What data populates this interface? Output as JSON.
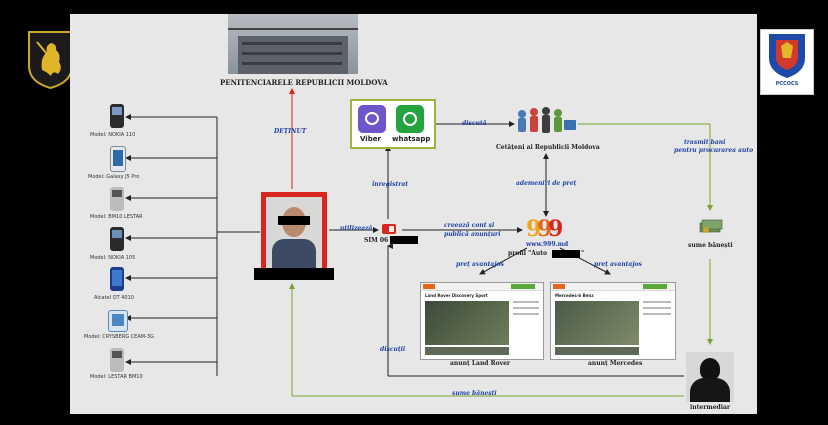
{
  "title": "PENITENCIARELE REPUBLICII MOLDOVA",
  "links": {
    "detinut": "DEȚINUT",
    "discuta": "discută",
    "inregistrat": "înregistrat",
    "utilizeaza": "utilizează",
    "creeaza_cont": "creează cont și",
    "publica_anunturi": "publică anunțuri",
    "ademeniri": "ademeniri de preț",
    "transmit_bani": "trasmit bani",
    "pentru_procurare": "pentru procurarea auto",
    "pret_avantajos_1": "preț avantajos",
    "pret_avantajos_2": "preț avantajos",
    "discutii": "discuții",
    "sume_banesti_bottom": "sume bănești"
  },
  "apps": {
    "viber": "Viber",
    "whatsapp": "whatsapp"
  },
  "citizens_label": "Cetățeni ai Republicii Moldova",
  "sim_label": "SIM 06",
  "site": {
    "url": "www.999.md",
    "profile_prefix": "profil \"Auto",
    "profile_suffix": "\""
  },
  "money_label": "sume bănești",
  "intermediary_label": "intermediar",
  "ads": {
    "land_rover": "anunț Land Rover",
    "mercedes": "anunț Mercedes",
    "land_rover_heading": "Land Rover Discovery Sport",
    "mercedes_heading": "Mercedes-b Benz"
  },
  "phones": [
    {
      "model": "Model: NOKIA 110"
    },
    {
      "model": "Model: Galaxy J5 Pro"
    },
    {
      "model": "Model: BM10 LESTAR"
    },
    {
      "model": "Model: NOKIA 105"
    },
    {
      "model": "Alcatel OT 4010"
    },
    {
      "model": "Model: CRYSBERG CEAM-3G"
    },
    {
      "model": "Model: LESTAR BM10"
    }
  ],
  "logo_right": "PCCOCS",
  "colors": {
    "red": "#d9261c",
    "blue": "#1e3fa8",
    "green": "#7aa32c",
    "board": "#e6e7e6"
  }
}
